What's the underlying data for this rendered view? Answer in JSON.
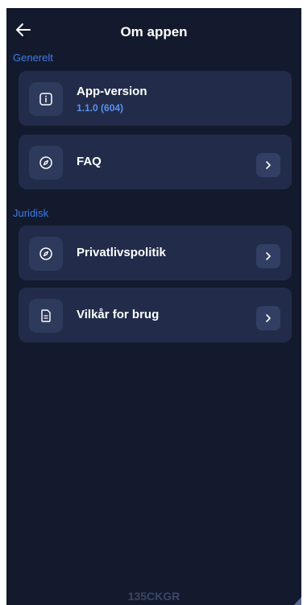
{
  "header": {
    "title": "Om appen",
    "back_icon": "arrow-left-icon"
  },
  "sections": [
    {
      "label": "Generelt",
      "items": [
        {
          "label": "App-version",
          "sublabel": "1.1.0 (604)",
          "icon": "info-icon",
          "has_chevron": false
        },
        {
          "label": "FAQ",
          "icon": "compass-icon",
          "has_chevron": true
        }
      ]
    },
    {
      "label": "Juridisk",
      "items": [
        {
          "label": "Privatlivspolitik",
          "icon": "compass-icon",
          "has_chevron": true
        },
        {
          "label": "Vilkår for brug",
          "icon": "document-icon",
          "has_chevron": true
        }
      ]
    }
  ],
  "footer": {
    "code": "135CKGR"
  },
  "colors": {
    "background": "#141a2d",
    "card": "#222c4a",
    "icon_box": "#2e3a5c",
    "accent": "#3d7be6",
    "text": "#ffffff"
  }
}
